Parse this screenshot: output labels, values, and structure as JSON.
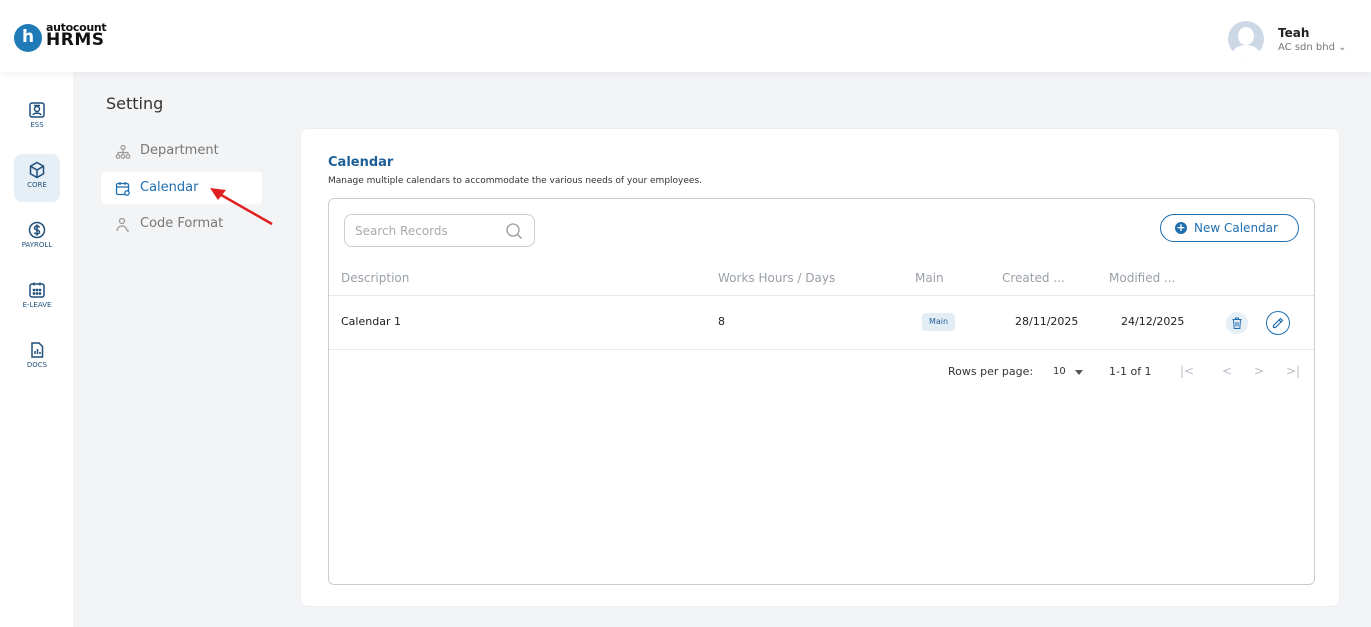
{
  "brand": {
    "logo_letter": "h",
    "logo_small": "autocount",
    "logo_big": "HRMS"
  },
  "user": {
    "name": "Teah",
    "company": "AC sdn bhd ⌄"
  },
  "rail": [
    {
      "label": "ESS",
      "icon": "ess-icon"
    },
    {
      "label": "CORE",
      "icon": "core-icon"
    },
    {
      "label": "PAYROLL",
      "icon": "payroll-icon"
    },
    {
      "label": "E-LEAVE",
      "icon": "eleave-icon"
    },
    {
      "label": "DOCS",
      "icon": "docs-icon"
    }
  ],
  "setting": {
    "title": "Setting",
    "nav": [
      {
        "label": "Department",
        "icon": "department-icon"
      },
      {
        "label": "Calendar",
        "icon": "calendar-icon"
      },
      {
        "label": "Code Format",
        "icon": "code-format-icon"
      }
    ]
  },
  "calendar_page": {
    "title": "Calendar",
    "description": "Manage multiple calendars to accommodate the various needs of your employees.",
    "search_placeholder": "Search Records",
    "new_button": "New Calendar",
    "columns": [
      "Description",
      "Works Hours / Days",
      "Main",
      "Created ...",
      "Modified ..."
    ],
    "rows": [
      {
        "description": "Calendar 1",
        "hours": "8",
        "main": "Main",
        "created": "28/11/2025",
        "modified": "24/12/2025"
      }
    ],
    "footer": {
      "rows_per_page_label": "Rows per page:",
      "rows_per_page_value": "10",
      "range": "1-1 of 1",
      "first": "|<",
      "prev": "<",
      "next": ">",
      "last": ">|"
    }
  },
  "colors": {
    "accent": "#1f6fb0",
    "annotation_arrow": "#e02020"
  }
}
